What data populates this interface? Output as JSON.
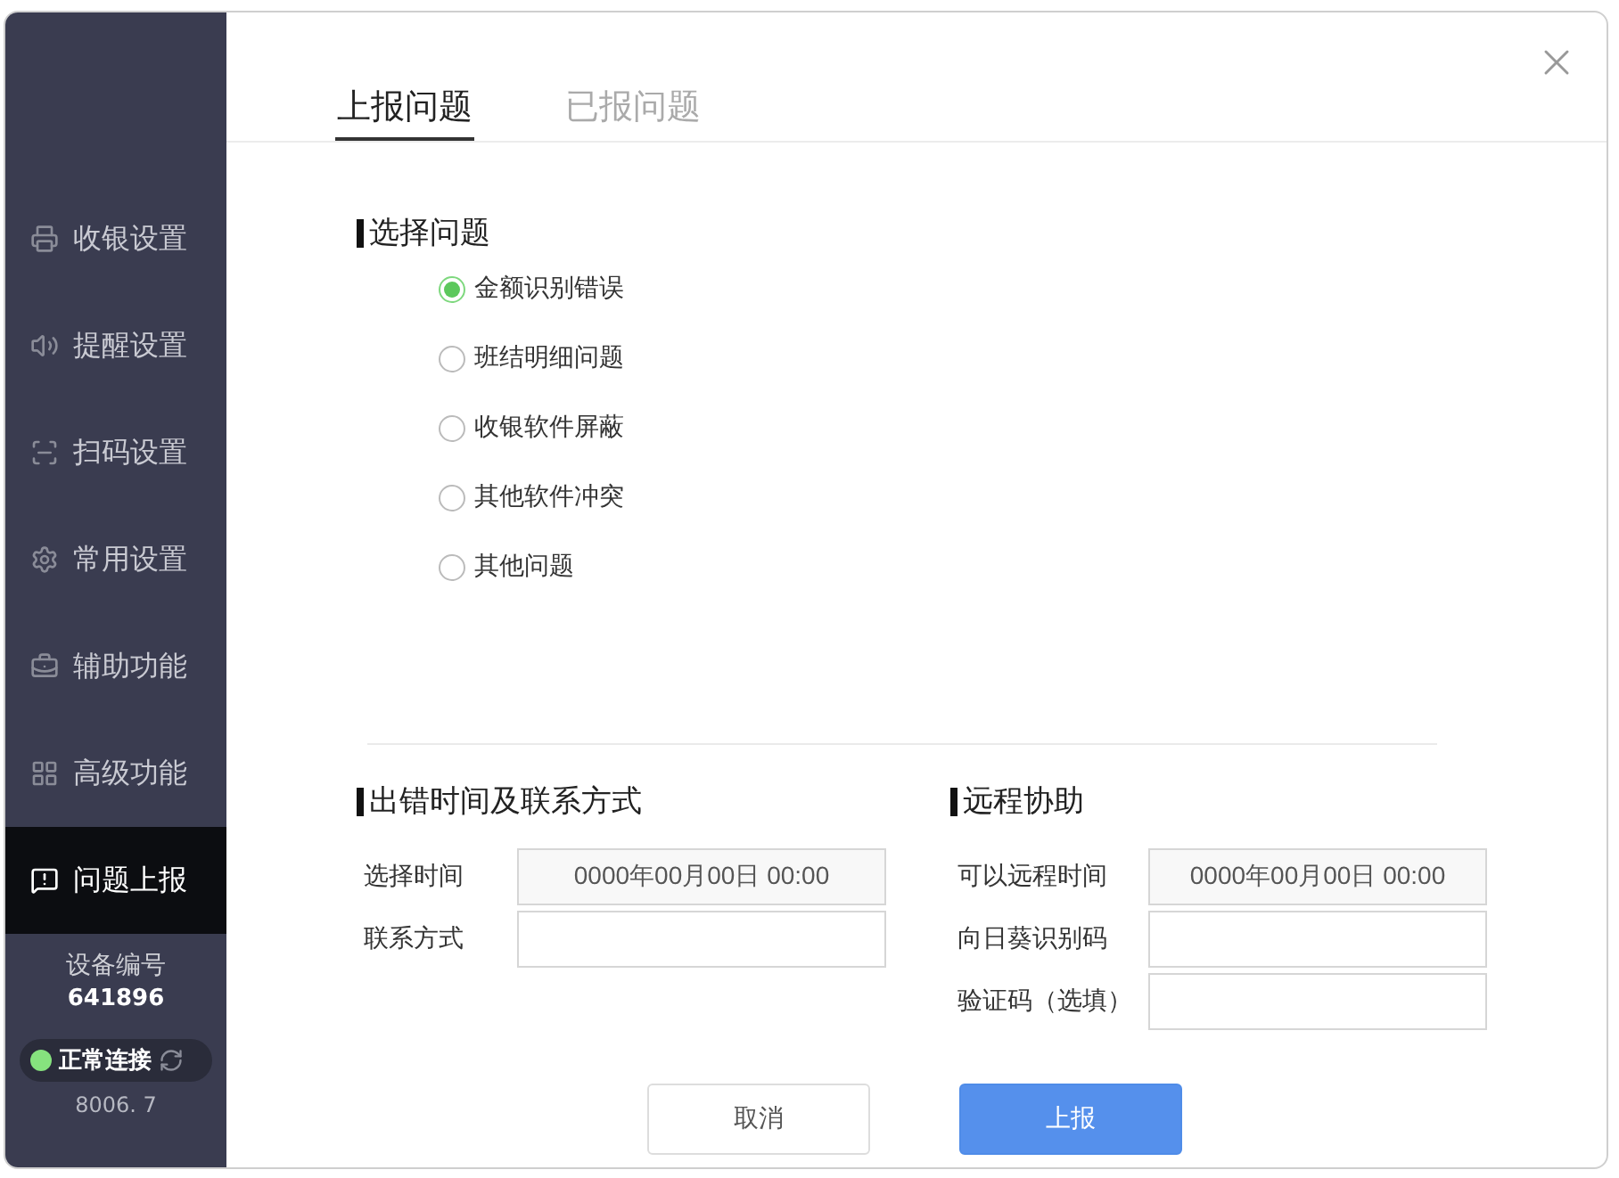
{
  "sidebar": {
    "items": [
      {
        "label": "收银设置",
        "selected": false
      },
      {
        "label": "提醒设置",
        "selected": false
      },
      {
        "label": "扫码设置",
        "selected": false
      },
      {
        "label": "常用设置",
        "selected": false
      },
      {
        "label": "辅助功能",
        "selected": false
      },
      {
        "label": "高级功能",
        "selected": false
      },
      {
        "label": "问题上报",
        "selected": true
      }
    ],
    "device_label": "设备编号",
    "device_number": "641896",
    "status": {
      "text": "正常连接",
      "color": "#86e27e"
    },
    "version": "8006. 7"
  },
  "tabs": [
    {
      "label": "上报问题",
      "selected": true
    },
    {
      "label": "已报问题",
      "selected": false
    }
  ],
  "question_section": {
    "title": "选择问题",
    "options": [
      {
        "label": "金额识别错误",
        "selected": true
      },
      {
        "label": "班结明细问题",
        "selected": false
      },
      {
        "label": "收银软件屏蔽",
        "selected": false
      },
      {
        "label": "其他软件冲突",
        "selected": false
      },
      {
        "label": "其他问题",
        "selected": false
      }
    ]
  },
  "contact_section": {
    "title": "出错时间及联系方式",
    "fields": [
      {
        "label": "选择时间",
        "kind": "time",
        "value": "0000年00月00日 00:00"
      },
      {
        "label": "联系方式",
        "kind": "text"
      }
    ]
  },
  "remote_section": {
    "title": "远程协助",
    "fields": [
      {
        "label": "可以远程时间",
        "kind": "time",
        "value": "0000年00月00日 00:00"
      },
      {
        "label": "向日葵识别码",
        "kind": "text"
      },
      {
        "label": "验证码（选填）",
        "kind": "text"
      }
    ]
  },
  "buttons": [
    {
      "label": "取消",
      "kind": "secondary"
    },
    {
      "label": "上报",
      "kind": "primary"
    }
  ]
}
